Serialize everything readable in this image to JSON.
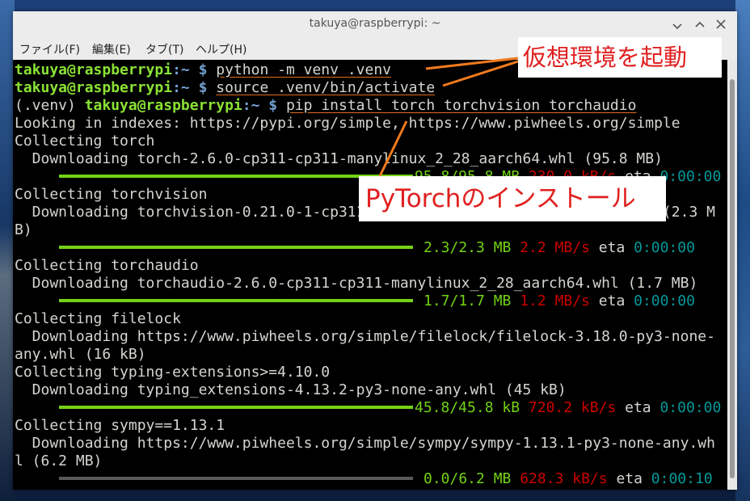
{
  "window": {
    "title": "takuya@raspberrypi: ~"
  },
  "menu": {
    "file": "ファイル(F)",
    "edit": "編集(E)",
    "tabs": "タブ(T)",
    "help": "ヘルプ(H)"
  },
  "terminal": {
    "user": "takuya@raspberrypi",
    "path_sep": ":~ $ ",
    "venv": "(.venv) ",
    "cmd1": "python -m venv .venv",
    "cmd2": "source .venv/bin/activate",
    "cmd3": "pip install torch torchvision torchaudio",
    "indexes": "Looking in indexes: https://pypi.org/simple, https://www.piwheels.org/simple",
    "collect_torch": "Collecting torch",
    "dl_torch": "  Downloading torch-2.6.0-cp311-cp311-manylinux_2_28_aarch64.whl (95.8 MB)",
    "prog_torch": {
      "size": "95.8/95.8 MB",
      "speed": "230.0 kB/s",
      "eta_label": "eta",
      "eta": "0:00:00",
      "progress": 1.0
    },
    "collect_vision": "Collecting torchvision",
    "dl_vision_a": "  Downloading torchvision-0.21.0-1-cp311-cp311-manylinux_2_28_aarch64.whl (2.3 M",
    "dl_vision_b": "B)",
    "prog_vision": {
      "size": "2.3/2.3 MB",
      "speed": "2.2 MB/s",
      "eta_label": "eta",
      "eta": "0:00:00",
      "progress": 1.0
    },
    "collect_audio": "Collecting torchaudio",
    "dl_audio": "  Downloading torchaudio-2.6.0-cp311-cp311-manylinux_2_28_aarch64.whl (1.7 MB)",
    "prog_audio": {
      "size": "1.7/1.7 MB",
      "speed": "1.2 MB/s",
      "eta_label": "eta",
      "eta": "0:00:00",
      "progress": 1.0
    },
    "collect_filelock": "Collecting filelock",
    "dl_filelock_a": "  Downloading https://www.piwheels.org/simple/filelock/filelock-3.18.0-py3-none-",
    "dl_filelock_b": "any.whl (16 kB)",
    "collect_typing": "Collecting typing-extensions>=4.10.0",
    "dl_typing": "  Downloading typing_extensions-4.13.2-py3-none-any.whl (45 kB)",
    "prog_typing": {
      "size": "45.8/45.8 kB",
      "speed": "720.2 kB/s",
      "eta_label": "eta",
      "eta": "0:00:00",
      "progress": 1.0
    },
    "collect_sympy": "Collecting sympy==1.13.1",
    "dl_sympy_a": "  Downloading https://www.piwheels.org/simple/sympy/sympy-1.13.1-py3-none-any.wh",
    "dl_sympy_b": "l (6.2 MB)",
    "prog_sympy": {
      "size": "0.0/6.2 MB",
      "speed": "628.3 kB/s",
      "eta_label": "eta",
      "eta": "0:00:10",
      "progress": 0.0
    }
  },
  "annotations": {
    "venv_label": "仮想環境を起動",
    "install_label": "PyTorchのインストール",
    "color": "#e02020",
    "arrow_color": "#f07a1e"
  },
  "colors": {
    "user_green": "#8ae234",
    "path_blue": "#729fcf",
    "progress_green": "#73d216",
    "speed_red": "#cc0000",
    "eta_cyan": "#06989a"
  }
}
